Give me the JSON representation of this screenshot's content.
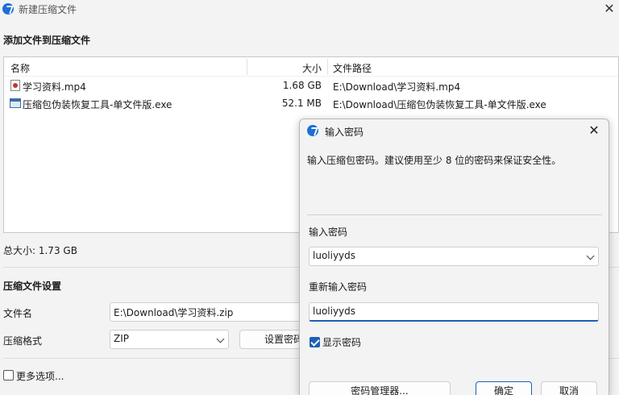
{
  "window": {
    "title": "新建压缩文件"
  },
  "add_section": {
    "heading": "添加文件到压缩文件"
  },
  "file_list": {
    "columns": {
      "name": "名称",
      "size": "大小",
      "path": "文件路径"
    },
    "rows": [
      {
        "name": "学习资料.mp4",
        "size": "1.68 GB",
        "path": "E:\\Download\\学习资料.mp4",
        "icon": "video-file-icon"
      },
      {
        "name": "压缩包伪装恢复工具-单文件版.exe",
        "size": "52.1 MB",
        "path": "E:\\Download\\压缩包伪装恢复工具-单文件版.exe",
        "icon": "exe-file-icon"
      }
    ]
  },
  "total": {
    "label": "总大小: 1.73 GB"
  },
  "settings": {
    "heading": "压缩文件设置",
    "filename_label": "文件名",
    "filename_value": "E:\\Download\\学习资料.zip",
    "format_label": "压缩格式",
    "format_value": "ZIP",
    "set_password_button": "设置密码",
    "more_options_label": "更多选项..."
  },
  "dialog": {
    "title": "输入密码",
    "description": "输入压缩包密码。建议使用至少 8 位的密码来保证安全性。",
    "password_label": "输入密码",
    "password_value": "luoliyyds",
    "confirm_label": "重新输入密码",
    "confirm_value": "luoliyyds",
    "show_password_label": "显示密码",
    "show_password_checked": true,
    "manager_button": "密码管理器...",
    "ok_button": "确定",
    "cancel_button": "取消"
  },
  "colors": {
    "accent": "#1d5fb8",
    "app_icon": "#1d6fd6"
  }
}
